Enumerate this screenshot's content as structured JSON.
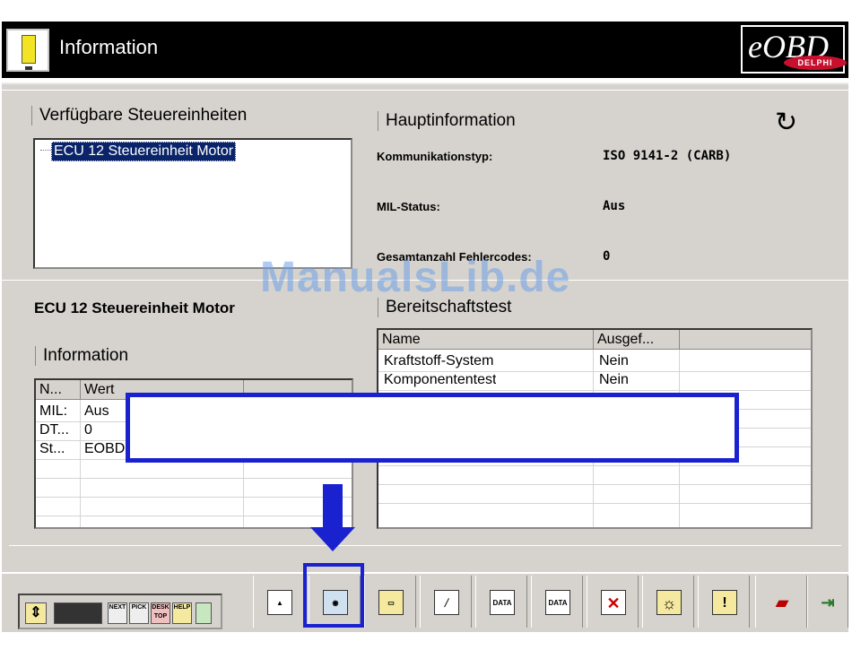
{
  "window": {
    "title": "Information",
    "logo_text": "eOBD",
    "logo_brand": "DELPHI"
  },
  "left": {
    "available_title": "Verfügbare Steuereinheiten",
    "available_items": [
      "ECU 12 Steuereinheit Motor"
    ],
    "selected_ecu": "ECU 12 Steuereinheit Motor",
    "info_title": "Information",
    "info_table": {
      "headers": [
        "N...",
        "Wert"
      ],
      "rows": [
        [
          "MIL:",
          "Aus"
        ],
        [
          "DT...",
          "0"
        ],
        [
          "St...",
          "EOBD"
        ]
      ]
    }
  },
  "right": {
    "main_title": "Hauptinformation",
    "fields": [
      {
        "label": "Kommunikationstyp:",
        "value": "ISO 9141-2 (CARB)"
      },
      {
        "label": "MIL-Status:",
        "value": "Aus"
      },
      {
        "label": "Gesamtanzahl Fehlercodes:",
        "value": "0"
      }
    ],
    "readiness_title": "Bereitschaftstest",
    "readiness_table": {
      "headers": [
        "Name",
        "Ausgef..."
      ],
      "rows": [
        [
          "Kraftstoff-System",
          "Nein"
        ],
        [
          "Komponententest",
          "Nein"
        ]
      ]
    }
  },
  "watermark": "ManualsLib.de",
  "toolbar": {
    "small_buttons": [
      "NEXT",
      "PICK",
      "DESK TOP",
      "HELP"
    ],
    "data_labels": [
      "DATA",
      "DATA"
    ],
    "icons": [
      "move-icon",
      "keyboard-icon",
      "next-icon",
      "pick-icon",
      "desktop-icon",
      "help-icon",
      "trash-icon",
      "joystick-icon",
      "eye-icon",
      "folder-icon",
      "spark-plug-icon",
      "data-freeze-icon",
      "data-graph-icon",
      "cancel-icon",
      "sun-icon",
      "warning-icon",
      "car-icon",
      "exit-icon"
    ]
  },
  "colors": {
    "highlight": "#1a22d0",
    "selection": "#0a246a",
    "panel": "#d6d3ce"
  }
}
